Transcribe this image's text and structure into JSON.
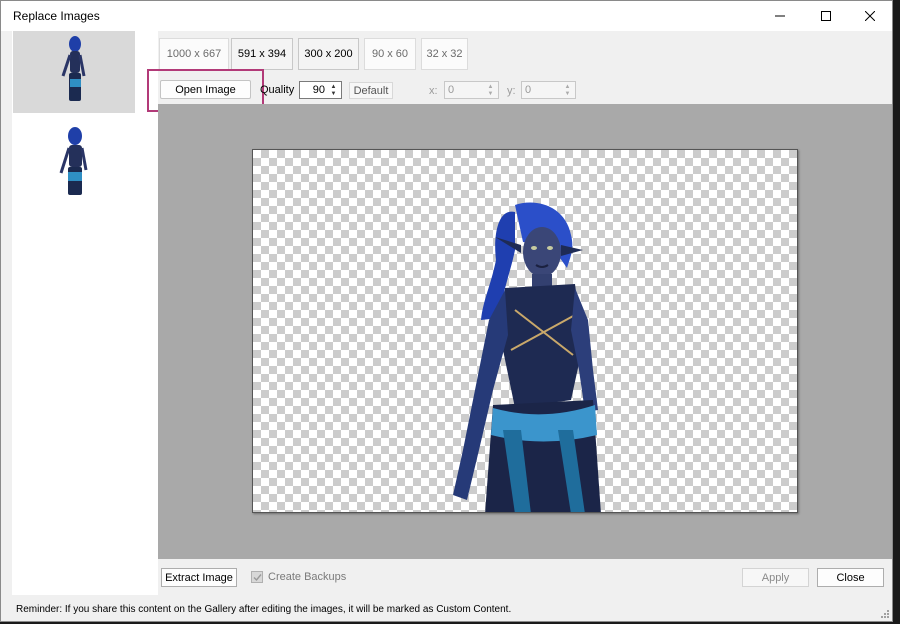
{
  "window": {
    "title": "Replace Images",
    "controls": [
      "minimize-icon",
      "maximize-icon",
      "close-icon"
    ]
  },
  "sizes": [
    {
      "label": "1000 x 667",
      "enabled": false
    },
    {
      "label": "591 x 394",
      "enabled": true
    },
    {
      "label": "300 x 200",
      "enabled": true
    },
    {
      "label": "90 x 60",
      "enabled": false
    },
    {
      "label": "32 x 32",
      "enabled": false
    }
  ],
  "toolbar": {
    "open_image_label": "Open Image",
    "quality_label": "Quality",
    "quality_value": "90",
    "default_label": "Default",
    "x_label": "x:",
    "x_value": "0",
    "y_label": "y:",
    "y_value": "0"
  },
  "footer": {
    "extract_label": "Extract Image",
    "create_backups_label": "Create Backups",
    "create_backups_checked": true,
    "apply_label": "Apply",
    "close_label": "Close",
    "reminder": "Reminder: If you share this content on the Gallery after editing the images, it will be marked as Custom Content."
  },
  "colors": {
    "highlight": "#b23a78",
    "preview_bg": "#a9a9a9"
  }
}
